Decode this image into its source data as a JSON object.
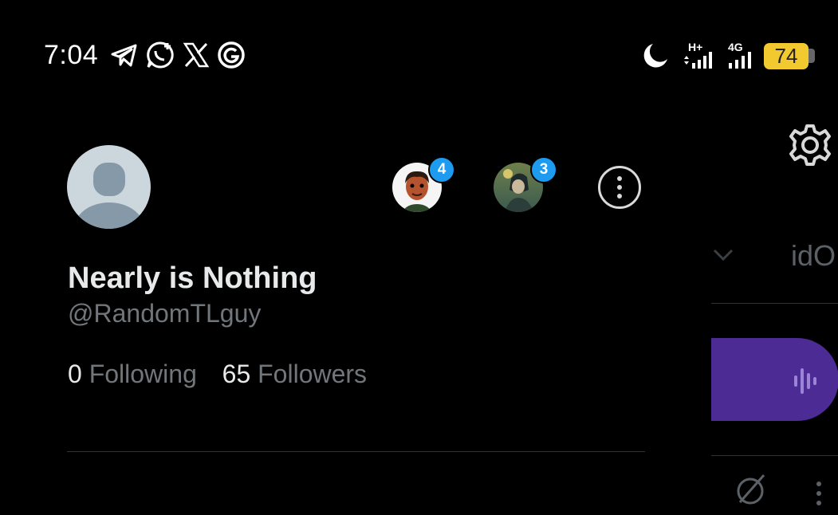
{
  "status_bar": {
    "time": "7:04",
    "notification_icons": [
      "telegram-icon",
      "whatsapp-icon",
      "x-logo-icon",
      "grok-icon"
    ],
    "network_1": "H+",
    "network_2": "4G",
    "battery": "74",
    "battery_color": "#f3c930"
  },
  "profile": {
    "display_name": "Nearly is Nothing",
    "handle": "@RandomTLguy",
    "following_count": "0",
    "following_label": "Following",
    "followers_count": "65",
    "followers_label": "Followers"
  },
  "accounts": [
    {
      "badge": "4"
    },
    {
      "badge": "3"
    }
  ],
  "background_panel": {
    "partial_text": "idO"
  },
  "colors": {
    "accent": "#1d9bf0",
    "voice_button": "#4c2b94",
    "muted_text": "#71767b"
  }
}
